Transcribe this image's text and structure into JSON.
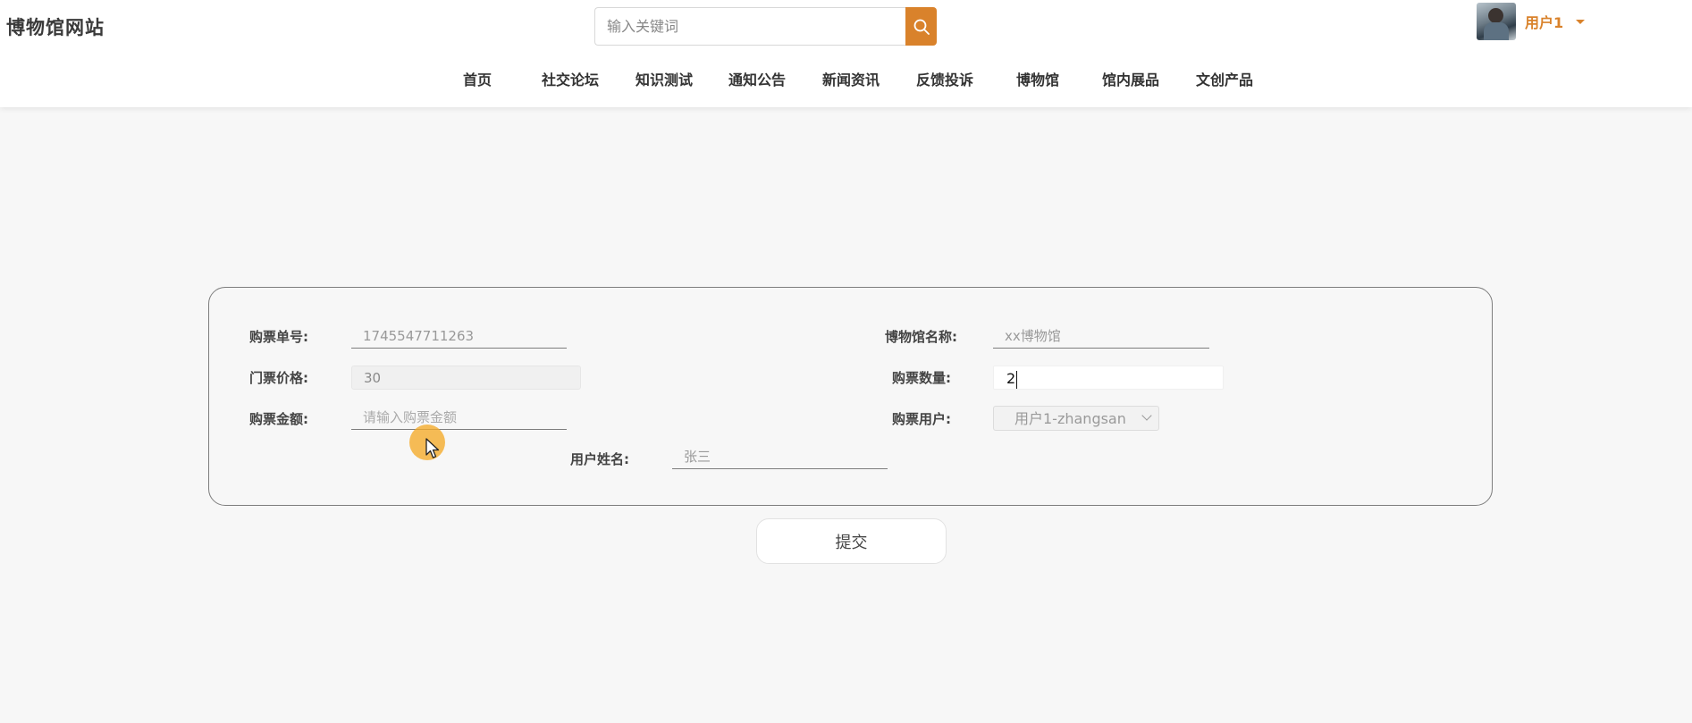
{
  "header": {
    "site_title": "博物馆网站",
    "search": {
      "placeholder": "输入关键词",
      "button_icon": "search-icon"
    },
    "user": {
      "name": "用户1",
      "avatar_icon": "avatar-photo",
      "dropdown_icon": "caret-down-icon"
    }
  },
  "nav": {
    "items": [
      {
        "label": "首页"
      },
      {
        "label": "社交论坛"
      },
      {
        "label": "知识测试"
      },
      {
        "label": "通知公告"
      },
      {
        "label": "新闻资讯"
      },
      {
        "label": "反馈投诉"
      },
      {
        "label": "博物馆"
      },
      {
        "label": "馆内展品"
      },
      {
        "label": "文创产品"
      }
    ]
  },
  "form": {
    "order_no": {
      "label": "购票单号:",
      "value": "1745547711263"
    },
    "museum_name": {
      "label": "博物馆名称:",
      "value": "xx博物馆"
    },
    "ticket_price": {
      "label": "门票价格:",
      "value": "30"
    },
    "quantity": {
      "label": "购票数量:",
      "value": "2"
    },
    "amount": {
      "label": "购票金额:",
      "placeholder": "请输入购票金额"
    },
    "buyer": {
      "label": "购票用户:",
      "value": "用户1-zhangsan"
    },
    "user_name": {
      "label": "用户姓名:",
      "value": "张三"
    },
    "submit_label": "提交"
  },
  "colors": {
    "accent": "#d9822b",
    "page_background": "#f7f7f7",
    "card_border": "#7d7d7d",
    "cursor_highlight": "#f5aa28"
  }
}
